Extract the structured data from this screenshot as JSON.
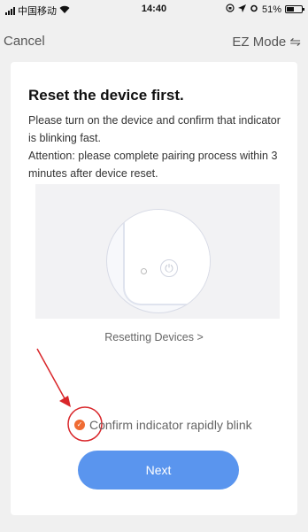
{
  "status_bar": {
    "carrier": "中国移动",
    "time": "14:40",
    "battery": "51%",
    "battery_level": 0.51
  },
  "nav": {
    "cancel_label": "Cancel",
    "mode_label": "EZ Mode ⇋"
  },
  "content": {
    "title": "Reset the device first.",
    "description": "Please turn on the device and confirm that indicator is blinking fast.",
    "attention": "Attention: please complete pairing process within 3 minutes after device reset.",
    "resetting_link": "Resetting Devices >",
    "confirm_label": "Confirm indicator rapidly blink",
    "confirm_checked": true,
    "next_label": "Next"
  },
  "colors": {
    "accent": "#ef6c33",
    "primary_button": "#5a95ee",
    "annotation": "#d9262a"
  }
}
